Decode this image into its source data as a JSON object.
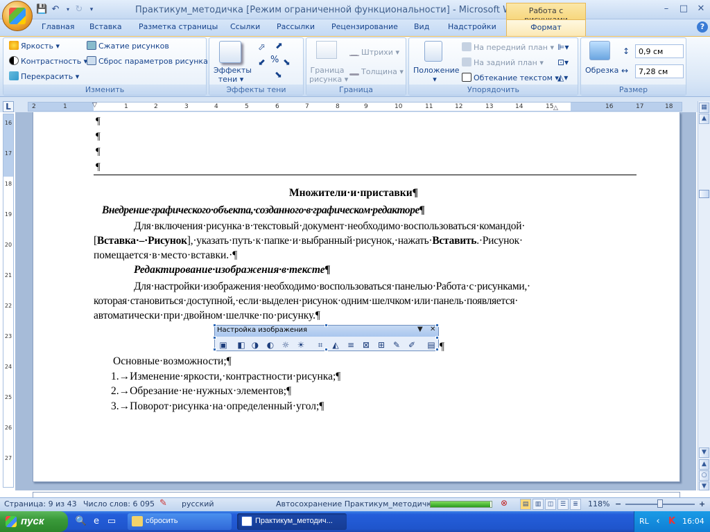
{
  "window": {
    "title": "Практикум_методичка [Режим ограниченной функциональности] - Microsoft Word",
    "context_tab_title": "Работа с рисунками",
    "minimize": "–",
    "maximize": "□",
    "close": "✕"
  },
  "tabs": [
    "Главная",
    "Вставка",
    "Разметка страницы",
    "Ссылки",
    "Рассылки",
    "Рецензирование",
    "Вид",
    "Надстройки"
  ],
  "active_tab": "Формат",
  "ribbon": {
    "izmenit": {
      "label": "Изменить",
      "brightness": "Яркость",
      "contrast": "Контрастность",
      "recolor": "Перекрасить",
      "compress": "Сжатие рисунков",
      "reset": "Сброс параметров рисунка"
    },
    "shadow": {
      "label": "Эффекты тени",
      "button_line1": "Эффекты",
      "button_line2": "тени"
    },
    "border": {
      "label": "Граница",
      "button_line1": "Граница",
      "button_line2": "рисунка",
      "dashes": "Штрихи",
      "weight": "Толщина"
    },
    "arrange": {
      "label": "Упорядочить",
      "position": "Положение",
      "front": "На передний план",
      "back": "На задний план",
      "wrap": "Обтекание текстом"
    },
    "size": {
      "label": "Размер",
      "crop": "Обрезка",
      "height": "0,9 см",
      "width": "7,28 см"
    }
  },
  "ruler": {
    "corner": "L",
    "h_numbers": [
      "2",
      "1",
      "1",
      "2",
      "3",
      "4",
      "5",
      "6",
      "7",
      "8",
      "9",
      "10",
      "11",
      "12",
      "13",
      "14",
      "15",
      "16",
      "17",
      "18"
    ],
    "v_numbers": [
      "16",
      "17",
      "18",
      "19",
      "20",
      "21",
      "22",
      "23",
      "24",
      "25",
      "26",
      "27"
    ]
  },
  "document": {
    "empty_paras": [
      "¶",
      "¶",
      "¶",
      "¶"
    ],
    "heading": "Множители·и·приставки¶",
    "subheading1": "Внедрение·графического·объекта,·созданного·в·графическом·редакторе¶",
    "para1_line1": "Для·включения·рисунка·в·текстовый·документ·необходимо·воспользоваться·командой·",
    "para1_l2_a": "[",
    "para1_l2_b": "Вставка·–·Рисунок",
    "para1_l2_c": "],·указать·путь·к·папке·и·выбранный·рисунок,·нажать·",
    "para1_l2_d": "Вставить",
    "para1_l2_e": ".·Рисунок·",
    "para1_line3": "помещается·в·место·вставки.·¶",
    "subheading2": "Редактирование·изображения·в·тексте¶",
    "para2_line1": "Для·настройки·изображения·необходимо·воспользоваться·панелью·Работа·с·рисунками,·",
    "para2_line2": "которая·становиться·доступной,·если·выделен·рисунок·одним·шелчком·или·панель·появляется·",
    "para2_line3": "автоматически·при·двойном·шелчке·по·рисунку.¶",
    "after_image_mark": "¶",
    "list_intro": "Основные·возможности;¶",
    "list": [
      "1.→Изменение·яркости,·контрастности·рисунка;¶",
      "2.→Обрезание·не·нужных·элементов;¶",
      "3.→Поворот·рисунка·на·определенный·угол;¶"
    ]
  },
  "image_toolbar": {
    "title": "Настройка изображения",
    "dropdown": "▼",
    "close": "✕"
  },
  "status": {
    "page": "Страница: 9 из 43",
    "words": "Число слов: 6 095",
    "language": "русский",
    "autosave": "Автосохранение Практикум_методичка:",
    "autosave_progress": 0.98,
    "zoom": "118%",
    "zoom_minus": "−",
    "zoom_plus": "+"
  },
  "taskbar": {
    "start": "пуск",
    "items": [
      "сбросить",
      "Практикум_методич..."
    ],
    "lang": "RL",
    "clock": "16:04"
  },
  "colors": {
    "ribbon_blue": "#15428b",
    "context_tab": "#f7d77e",
    "taskbar": "#245edb",
    "start_green": "#3a9a3a"
  }
}
